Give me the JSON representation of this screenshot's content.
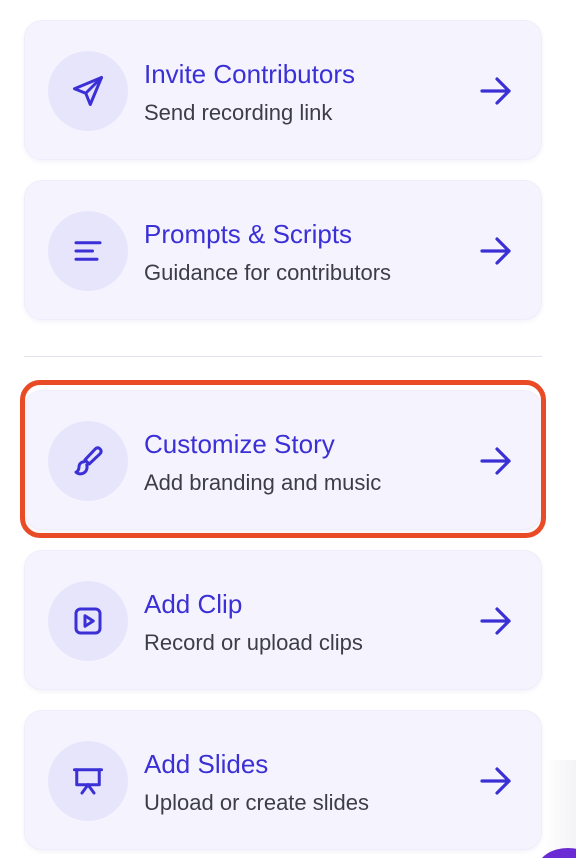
{
  "colors": {
    "accent": "#3b2fd6",
    "card_background": "#f5f4fe",
    "icon_circle_background": "#e7e5fb",
    "subtitle_text": "#3d3d4a",
    "highlight_outline": "#e94b27"
  },
  "menu": {
    "items": [
      {
        "title": "Invite Contributors",
        "subtitle": "Send recording link",
        "icon": "send-icon",
        "highlighted": false
      },
      {
        "title": "Prompts & Scripts",
        "subtitle": "Guidance for contributors",
        "icon": "text-lines-icon",
        "highlighted": false
      },
      {
        "title": "Customize Story",
        "subtitle": "Add branding and music",
        "icon": "paintbrush-icon",
        "highlighted": true
      },
      {
        "title": "Add Clip",
        "subtitle": "Record or upload clips",
        "icon": "play-square-icon",
        "highlighted": false
      },
      {
        "title": "Add Slides",
        "subtitle": "Upload or create slides",
        "icon": "presentation-icon",
        "highlighted": false
      }
    ]
  }
}
